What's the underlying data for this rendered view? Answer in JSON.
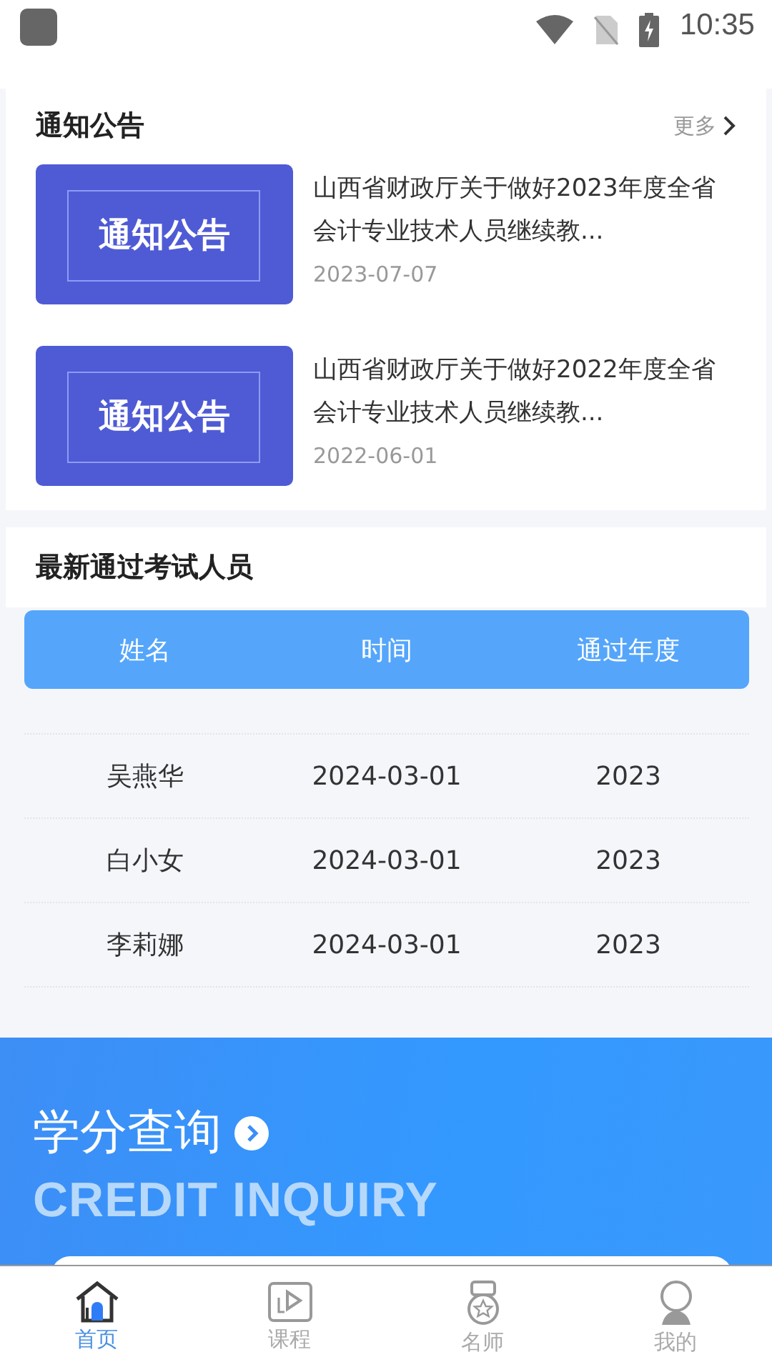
{
  "status_bar": {
    "time": "10:35"
  },
  "notices": {
    "title": "通知公告",
    "more": "更多",
    "items": [
      {
        "thumb_text": "通知公告",
        "title": "山西省财政厅关于做好2023年度全省会计专业技术人员继续教...",
        "date": "2023-07-07"
      },
      {
        "thumb_text": "通知公告",
        "title": "山西省财政厅关于做好2022年度全省会计专业技术人员继续教...",
        "date": "2022-06-01"
      }
    ]
  },
  "passed": {
    "title": "最新通过考试人员",
    "columns": [
      "姓名",
      "时间",
      "通过年度"
    ],
    "rows": [
      [
        "吴燕华",
        "2024-03-01",
        "2023"
      ],
      [
        "白小女",
        "2024-03-01",
        "2023"
      ],
      [
        "李莉娜",
        "2024-03-01",
        "2023"
      ]
    ]
  },
  "banner": {
    "title": "学分查询",
    "subtitle": "CREDIT INQUIRY"
  },
  "tabs": [
    {
      "label": "首页",
      "selected": true,
      "kind": "home"
    },
    {
      "label": "课程",
      "selected": false,
      "kind": "course"
    },
    {
      "label": "名师",
      "selected": false,
      "kind": "teacher"
    },
    {
      "label": "我的",
      "selected": false,
      "kind": "me"
    }
  ]
}
